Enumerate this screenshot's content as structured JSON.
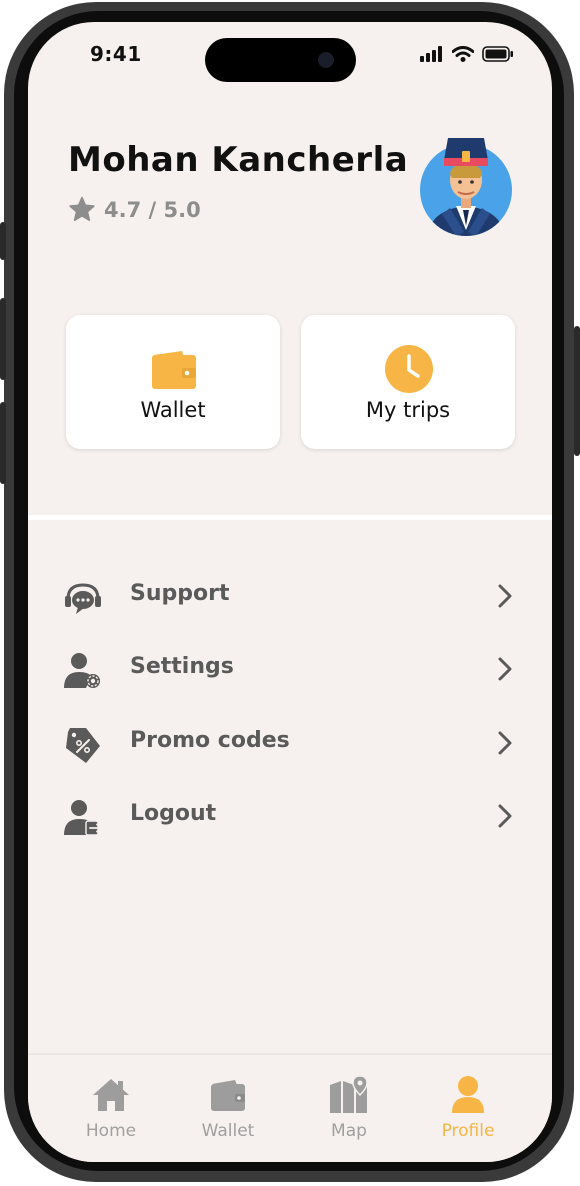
{
  "status_bar": {
    "time": "9:41"
  },
  "profile": {
    "name": "Mohan Kancherla",
    "rating": "4.7 / 5.0",
    "avatar_icon": "driver-avatar-icon"
  },
  "quick_actions": [
    {
      "label": "Wallet",
      "icon": "wallet-icon"
    },
    {
      "label": "My trips",
      "icon": "clock-icon"
    }
  ],
  "menu": [
    {
      "label": "Support",
      "icon": "support-chat-icon"
    },
    {
      "label": "Settings",
      "icon": "user-settings-icon"
    },
    {
      "label": "Promo codes",
      "icon": "promo-tag-icon"
    },
    {
      "label": "Logout",
      "icon": "user-logout-icon"
    }
  ],
  "bottom_nav": [
    {
      "label": "Home",
      "icon": "home-icon",
      "active": false
    },
    {
      "label": "Wallet",
      "icon": "wallet-icon",
      "active": false
    },
    {
      "label": "Map",
      "icon": "map-icon",
      "active": false
    },
    {
      "label": "Profile",
      "icon": "profile-icon",
      "active": true
    }
  ],
  "colors": {
    "accent": "#F6B544",
    "background": "#F6F1EE",
    "icon_gray": "#5A5A5A",
    "inactive": "#A0A0A0"
  }
}
